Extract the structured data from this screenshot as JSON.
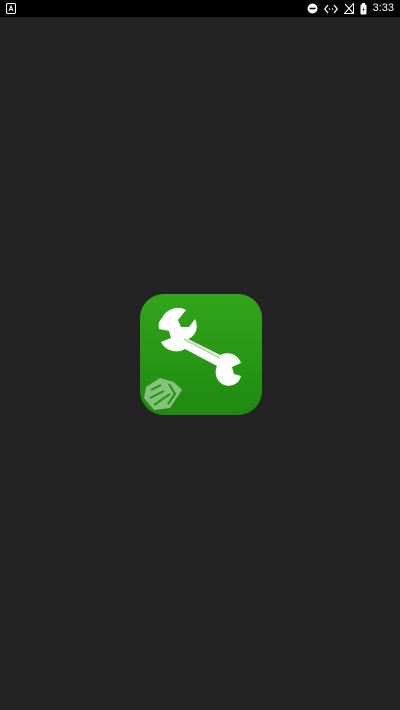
{
  "status_bar": {
    "time": "3:33",
    "icons": [
      "notification-icon",
      "dnd-icon",
      "code-icon",
      "no-signal-icon",
      "battery-icon"
    ]
  },
  "splash": {
    "app_icon": "wrench-icon",
    "badge": "sb-diamond-icon",
    "icon_bg_color": "#2a9a16",
    "screen_bg_color": "#232323"
  }
}
